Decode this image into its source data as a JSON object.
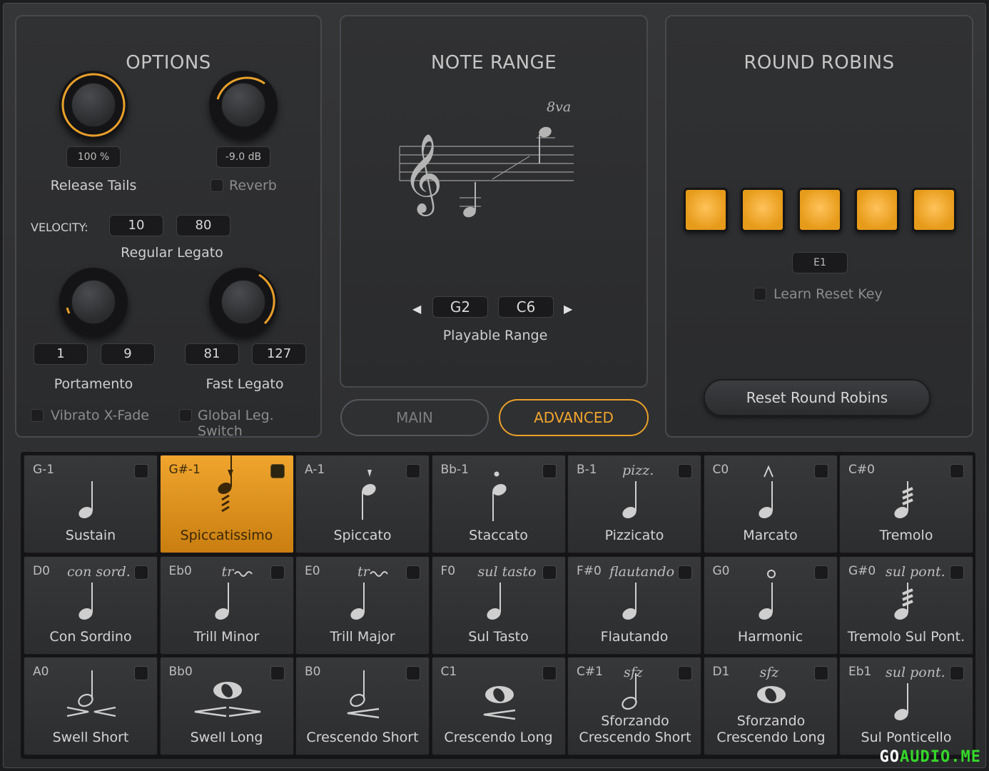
{
  "options": {
    "title": "OPTIONS",
    "release_value": "100 %",
    "release_label": "Release Tails",
    "reverb_value": "-9.0 dB",
    "reverb_label": "Reverb",
    "velocity_label": "VELOCITY:",
    "velocity_low": "10",
    "velocity_high": "80",
    "regular_legato_label": "Regular Legato",
    "portamento_low": "1",
    "portamento_high": "9",
    "portamento_label": "Portamento",
    "fast_low": "81",
    "fast_high": "127",
    "fast_label": "Fast Legato",
    "vibrato_label": "Vibrato X-Fade",
    "global_label": "Global Leg. Switch"
  },
  "note_range": {
    "title": "NOTE RANGE",
    "octave_marking": "8va",
    "low": "G2",
    "high": "C6",
    "label": "Playable Range"
  },
  "tabs": {
    "main": "MAIN",
    "advanced": "ADVANCED"
  },
  "round_robins": {
    "title": "ROUND ROBINS",
    "reset_key": "E1",
    "learn_label": "Learn Reset Key",
    "reset_button": "Reset Round Robins"
  },
  "articulations": [
    {
      "key": "G-1",
      "name": "Sustain",
      "marking": "",
      "icon": "quarter-note-icon"
    },
    {
      "key": "G#-1",
      "name": "Spiccatissimo",
      "marking": "",
      "icon": "spiccatissimo-note-icon"
    },
    {
      "key": "A-1",
      "name": "Spiccato",
      "marking": "",
      "icon": "spiccato-note-icon"
    },
    {
      "key": "Bb-1",
      "name": "Staccato",
      "marking": "",
      "icon": "staccato-note-icon"
    },
    {
      "key": "B-1",
      "name": "Pizzicato",
      "marking": "pizz.",
      "icon": "quarter-note-icon"
    },
    {
      "key": "C0",
      "name": "Marcato",
      "marking": "",
      "icon": "marcato-note-icon"
    },
    {
      "key": "C#0",
      "name": "Tremolo",
      "marking": "",
      "icon": "tremolo-note-icon"
    },
    {
      "key": "D0",
      "name": "Con Sordino",
      "marking": "con sord.",
      "icon": "quarter-note-icon"
    },
    {
      "key": "Eb0",
      "name": "Trill Minor",
      "marking": "tr",
      "icon": "trill-note-icon"
    },
    {
      "key": "E0",
      "name": "Trill Major",
      "marking": "tr",
      "icon": "trill-note-icon"
    },
    {
      "key": "F0",
      "name": "Sul Tasto",
      "marking": "sul tasto",
      "icon": "quarter-note-icon"
    },
    {
      "key": "F#0",
      "name": "Flautando",
      "marking": "flautando",
      "icon": "quarter-note-icon"
    },
    {
      "key": "G0",
      "name": "Harmonic",
      "marking": "",
      "icon": "harmonic-note-icon"
    },
    {
      "key": "G#0",
      "name": "Tremolo Sul Pont.",
      "marking": "sul pont.",
      "icon": "tremolo-note-icon"
    },
    {
      "key": "A0",
      "name": "Swell Short",
      "marking": "",
      "icon": "half-note-swell-icon"
    },
    {
      "key": "Bb0",
      "name": "Swell Long",
      "marking": "",
      "icon": "whole-note-swell-icon"
    },
    {
      "key": "B0",
      "name": "Crescendo Short",
      "marking": "",
      "icon": "half-note-crescendo-icon"
    },
    {
      "key": "C1",
      "name": "Crescendo Long",
      "marking": "",
      "icon": "whole-note-crescendo-icon"
    },
    {
      "key": "C#1",
      "name": "Sforzando Crescendo Short",
      "marking": "sfz",
      "icon": "half-note-sfz-icon"
    },
    {
      "key": "D1",
      "name": "Sforzando Crescendo Long",
      "marking": "sfz",
      "icon": "whole-note-sfz-icon"
    },
    {
      "key": "Eb1",
      "name": "Sul Ponticello",
      "marking": "sul pont.",
      "icon": "quarter-note-icon"
    }
  ],
  "watermark": {
    "left": "GO",
    "right": "AUDIO.ME"
  },
  "colors": {
    "accent": "#f0a52e",
    "panel": "#2e2f31"
  }
}
